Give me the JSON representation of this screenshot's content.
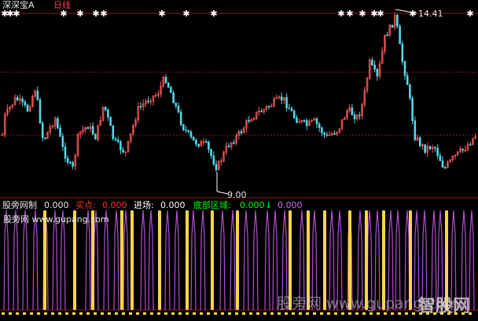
{
  "header": {
    "stock_name": "深深宝A",
    "period": "日线"
  },
  "price_labels": {
    "high": "14.41",
    "low": "9.00"
  },
  "indicator": {
    "name": "股旁网制",
    "value": "0.000",
    "buy_label": "买点:",
    "buy_value": "0.000",
    "entry_label": "进场:",
    "entry_value": "0.000",
    "bottom_label": "底部区域:",
    "bottom_value": "0.000",
    "bottom_arrow": "↓",
    "extra_value": "0.000",
    "site_line": "股旁网 www.gupang.com"
  },
  "watermark": {
    "text": "股旁网 www.gupang.com",
    "logo": "智股网"
  },
  "colors": {
    "background": "#000000",
    "up_candle": "#ff5a5a",
    "down_candle": "#54d8e8",
    "grid": "#8b1a1a",
    "yellow_bar": "#ffd54a",
    "purple_bar": "#b050d0",
    "bottom_area": "#00ff00",
    "buy": "#ff3030",
    "entry": "#ffffff"
  }
}
